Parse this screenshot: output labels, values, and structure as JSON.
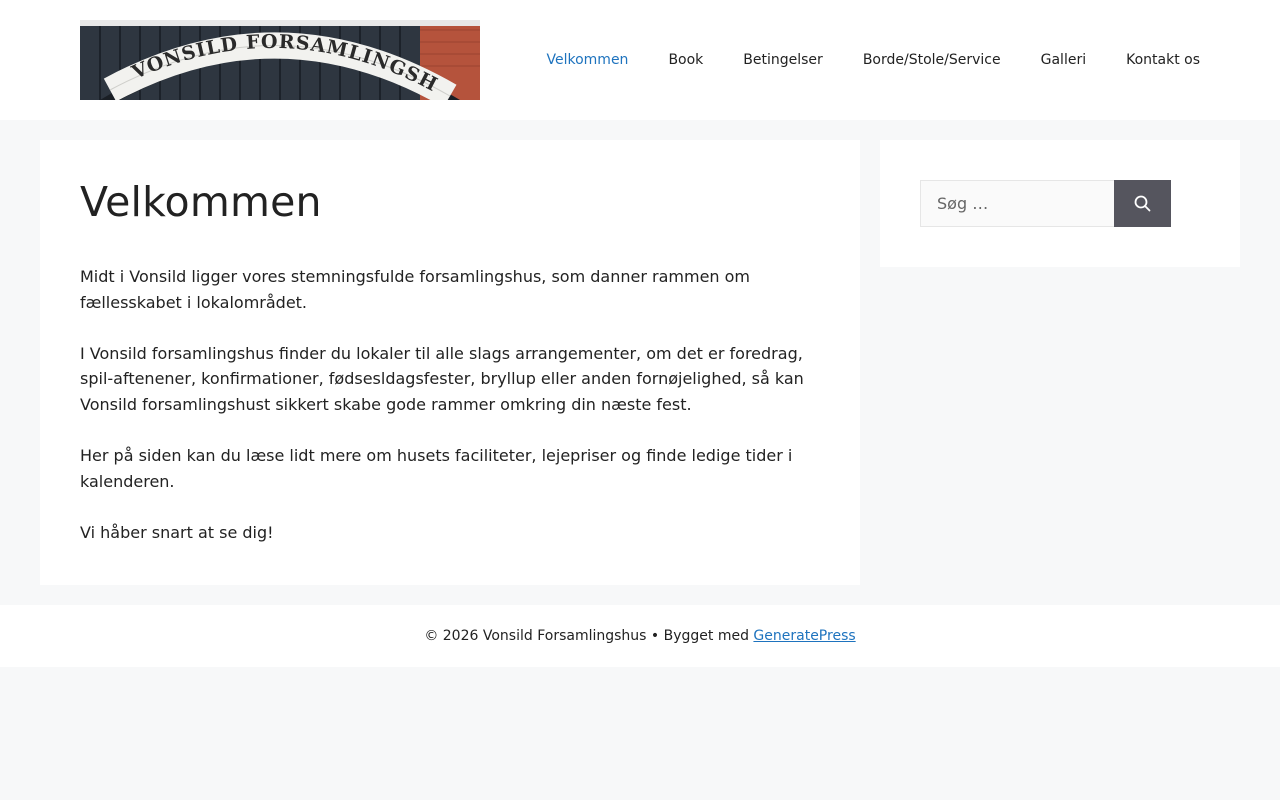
{
  "header": {
    "logo_text": "VONSILD FORSAMLINGSHUS",
    "nav": [
      {
        "label": "Velkommen",
        "active": true
      },
      {
        "label": "Book"
      },
      {
        "label": "Betingelser"
      },
      {
        "label": "Borde/Stole/Service"
      },
      {
        "label": "Galleri"
      },
      {
        "label": "Kontakt os"
      }
    ]
  },
  "main": {
    "title": "Velkommen",
    "paragraphs": [
      "Midt i Vonsild ligger vores stemningsfulde forsamlingshus, som danner rammen om fællesskabet i lokalområdet.",
      "I Vonsild forsamlingshus finder du lokaler til alle slags arrangementer, om det er foredrag, spil-aftenener, konfirmationer, fødsesldagsfester, bryllup eller anden fornøjelighed, så kan Vonsild forsamlingshust sikkert skabe gode rammer omkring din næste fest.",
      "Her på siden kan du læse lidt mere om husets faciliteter, lejepriser og finde ledige tider i kalenderen.",
      "Vi håber snart at se dig!"
    ]
  },
  "sidebar": {
    "search": {
      "placeholder": "Søg …",
      "value": "",
      "button_icon": "search-icon"
    }
  },
  "footer": {
    "copyright": "© 2026 Vonsild Forsamlingshus • Bygget med ",
    "link_text": "GeneratePress"
  },
  "colors": {
    "accent": "#1e73be",
    "page_bg": "#f7f8f9",
    "search_button": "#55555e"
  }
}
